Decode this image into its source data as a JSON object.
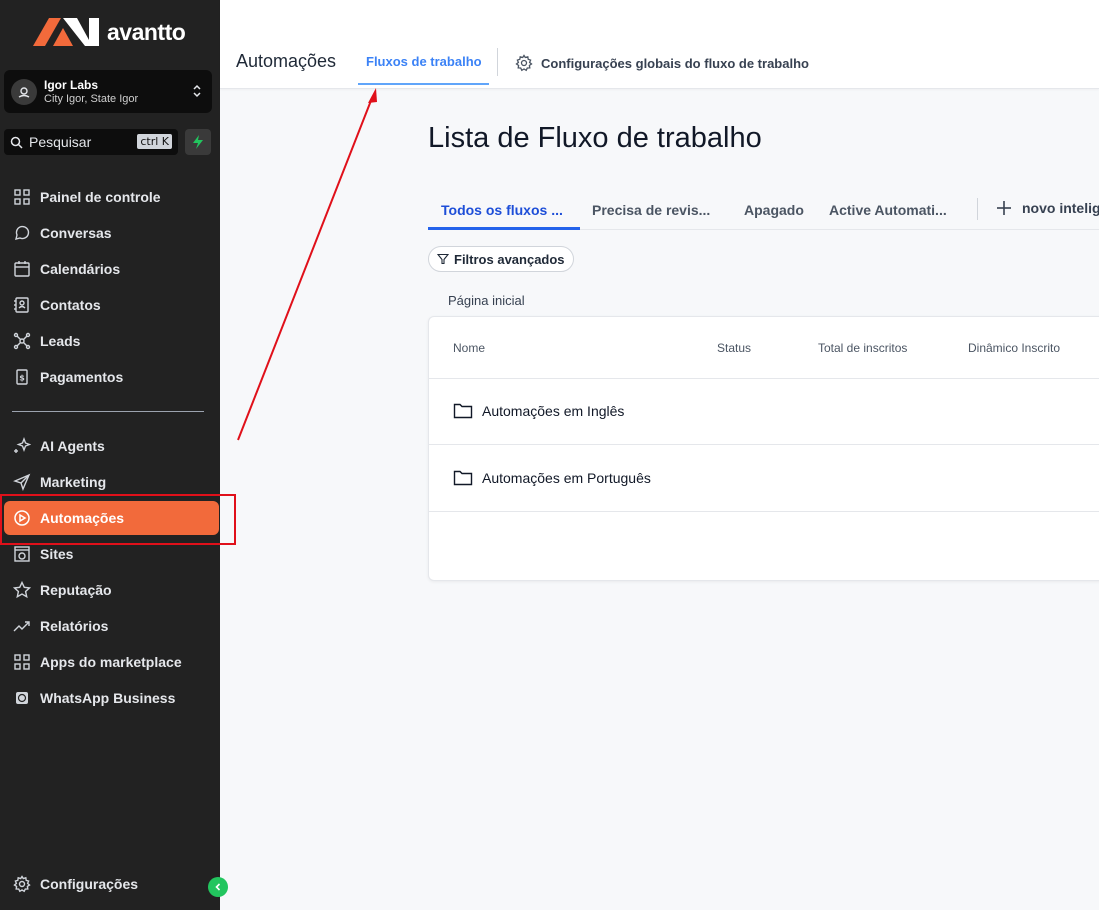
{
  "brand": {
    "name": "avantto",
    "accent": "#f26a3b",
    "annotation_color": "#e0101a"
  },
  "account": {
    "name": "Igor Labs",
    "location": "City Igor, State Igor"
  },
  "search": {
    "placeholder": "Pesquisar",
    "shortcut": "ctrl K"
  },
  "sidebar": {
    "items": [
      {
        "label": "Painel de controle",
        "icon": "grid-icon"
      },
      {
        "label": "Conversas",
        "icon": "chat-bubble-icon"
      },
      {
        "label": "Calendários",
        "icon": "calendar-icon"
      },
      {
        "label": "Contatos",
        "icon": "contacts-book-icon"
      },
      {
        "label": "Leads",
        "icon": "network-icon"
      },
      {
        "label": "Pagamentos",
        "icon": "receipt-icon"
      },
      {
        "label": "AI Agents",
        "icon": "sparkle-icon"
      },
      {
        "label": "Marketing",
        "icon": "paper-plane-icon"
      },
      {
        "label": "Automações",
        "icon": "automation-icon"
      },
      {
        "label": "Sites",
        "icon": "globe-window-icon"
      },
      {
        "label": "Reputação",
        "icon": "star-icon"
      },
      {
        "label": "Relatórios",
        "icon": "trend-line-icon"
      },
      {
        "label": "Apps do marketplace",
        "icon": "apps-grid-icon"
      },
      {
        "label": "WhatsApp Business",
        "icon": "whatsapp-icon"
      }
    ],
    "settings_label": "Configurações"
  },
  "topbar": {
    "title": "Automações",
    "tab_label": "Fluxos de trabalho",
    "settings_label": "Configurações globais do fluxo de trabalho"
  },
  "main": {
    "title": "Lista de Fluxo de trabalho",
    "tabs": [
      "Todos os fluxos ...",
      "Precisa de revis...",
      "Apagado",
      "Active Automati..."
    ],
    "new_label": "novo intelig",
    "filter_label": "Filtros avançados",
    "breadcrumb": "Página inicial",
    "table": {
      "columns": [
        "Nome",
        "Status",
        "Total de inscritos",
        "Dinâmico Inscrito"
      ],
      "rows": [
        {
          "name": "Automações em Inglês"
        },
        {
          "name": "Automações em Português"
        }
      ]
    }
  }
}
